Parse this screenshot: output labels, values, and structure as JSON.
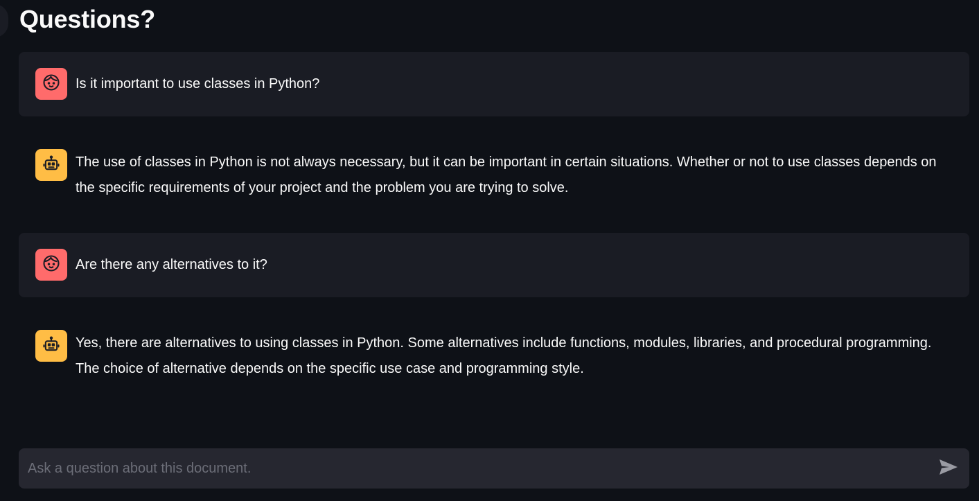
{
  "page": {
    "title": "Questions?"
  },
  "messages": [
    {
      "role": "user",
      "icon": "face-icon",
      "text": "Is it important to use classes in Python?"
    },
    {
      "role": "assistant",
      "icon": "robot-icon",
      "text": "The use of classes in Python is not always necessary, but it can be important in certain situations. Whether or not to use classes depends on the specific requirements of your project and the problem you are trying to solve."
    },
    {
      "role": "user",
      "icon": "face-icon",
      "text": "Are there any alternatives to it?"
    },
    {
      "role": "assistant",
      "icon": "robot-icon",
      "text": "Yes, there are alternatives to using classes in Python. Some alternatives include functions, modules, libraries, and procedural programming. The choice of alternative depends on the specific use case and programming style."
    }
  ],
  "chat_input": {
    "placeholder": "Ask a question about this document.",
    "value": "",
    "send_icon": "send-icon"
  },
  "colors": {
    "background": "#0e1117",
    "user_message_bg": "#1a1c24",
    "user_avatar": "#ff6b6b",
    "assistant_avatar": "#ffbd45",
    "input_bg": "#262730"
  }
}
